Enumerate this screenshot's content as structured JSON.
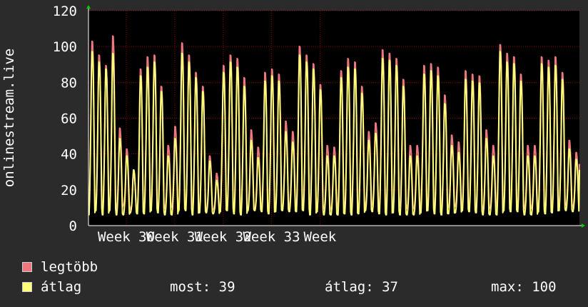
{
  "colors": {
    "background": "#2b2b2b",
    "plot_background": "#000000",
    "grid": "#ff0000",
    "axis": "#ffffff",
    "max_series": "#ec7880",
    "avg_series": "#ffff7a"
  },
  "chart_data": {
    "type": "line",
    "ylabel": "onlinestream.live",
    "ylim": [
      0,
      120
    ],
    "yticks": [
      0,
      20,
      40,
      60,
      80,
      100,
      120
    ],
    "x_tick_labels": [
      "Week 30",
      "Week 31",
      "Week 32",
      "Week 33",
      "Week"
    ],
    "grid": true,
    "series": [
      {
        "name": "legtöbb",
        "color": "#ec7880",
        "daily_peaks": [
          106,
          98,
          92,
          109,
          56,
          44,
          30,
          90,
          97,
          98,
          80,
          46,
          57,
          105,
          98,
          88,
          80,
          40,
          30,
          92,
          98,
          96,
          85,
          55,
          45,
          88,
          90,
          87,
          60,
          54,
          103,
          98,
          93,
          81,
          46,
          45,
          89,
          96,
          94,
          80,
          54,
          59,
          101,
          99,
          96,
          84,
          46,
          46,
          92,
          93,
          91,
          75,
          52,
          48,
          89,
          87,
          86,
          55,
          46,
          104,
          99,
          97,
          87,
          46,
          46,
          97,
          95,
          97,
          88,
          49,
          42
        ]
      },
      {
        "name": "átlag",
        "color": "#ffff7a",
        "daily_peaks": [
          100,
          94,
          90,
          99,
          50,
          40,
          32,
          86,
          91,
          94,
          77,
          40,
          50,
          99,
          94,
          85,
          77,
          37,
          26,
          88,
          94,
          91,
          80,
          49,
          39,
          83,
          86,
          83,
          54,
          48,
          98,
          94,
          90,
          78,
          40,
          40,
          85,
          91,
          90,
          76,
          49,
          53,
          96,
          95,
          92,
          80,
          40,
          40,
          87,
          89,
          86,
          70,
          46,
          42,
          84,
          83,
          82,
          50,
          40,
          100,
          94,
          93,
          83,
          40,
          40,
          93,
          91,
          92,
          84,
          44,
          38
        ]
      }
    ]
  },
  "legend": {
    "max_label": "legtöbb",
    "avg_label": "átlag"
  },
  "stats": {
    "current": "most: 39",
    "average": "átlag: 37",
    "maximum": "max: 100"
  }
}
